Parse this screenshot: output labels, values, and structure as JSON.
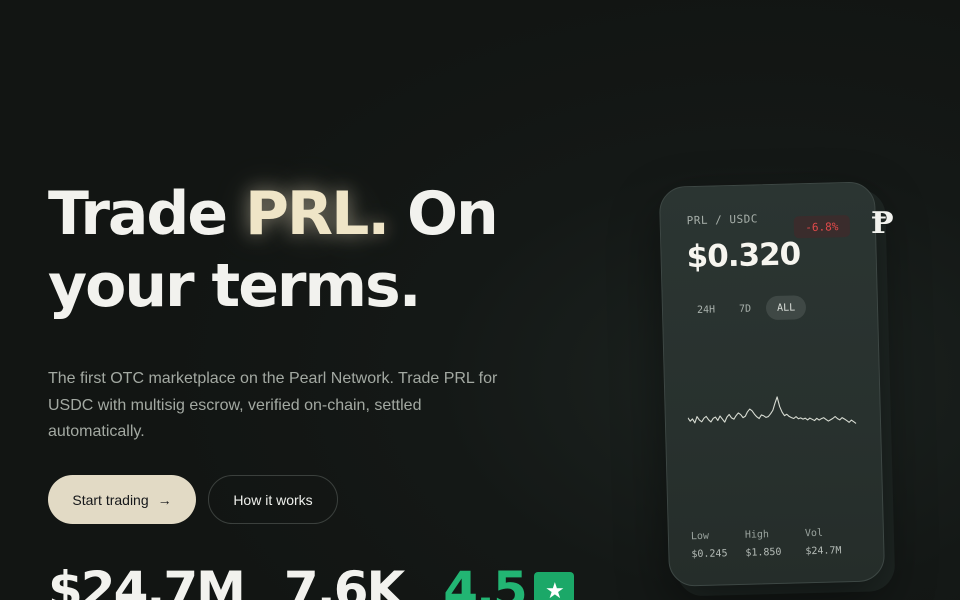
{
  "hero": {
    "title_prefix": "Trade ",
    "title_accent": "PRL.",
    "title_suffix": " On your terms.",
    "subtitle": "The first OTC marketplace on the Pearl Network. Trade PRL for USDC with multisig escrow, verified on-chain, settled automatically.",
    "primary_button": "Start trading",
    "primary_button_icon": "arrow-right-icon",
    "secondary_button": "How it works"
  },
  "stats": {
    "volume": "$24.7M",
    "trades": "7.6K",
    "rating": "4.5",
    "rating_icon": "star-icon"
  },
  "ticker_card": {
    "pair": "PRL / USDC",
    "change": "-6.8%",
    "price": "$0.320",
    "ranges": [
      "24H",
      "7D",
      "ALL"
    ],
    "selected_range": "ALL",
    "low_label": "Low",
    "low_value": "$0.245",
    "high_label": "High",
    "high_value": "$1.850",
    "vol_label": "Vol",
    "vol_value": "$24.7M"
  },
  "logo": {
    "glyph": "Ᵽ",
    "icon": "pearl-logo-icon"
  },
  "colors": {
    "background": "#141816",
    "accent": "#efe5c7",
    "primary_button": "#e2dac5",
    "positive": "#22b573",
    "negative": "#e04a4a",
    "card": "#2b3532"
  },
  "sparkline_points": [
    0.58,
    0.5,
    0.55,
    0.46,
    0.6,
    0.52,
    0.48,
    0.56,
    0.6,
    0.52,
    0.47,
    0.55,
    0.58,
    0.5,
    0.6,
    0.53,
    0.46,
    0.57,
    0.63,
    0.55,
    0.52,
    0.6,
    0.66,
    0.62,
    0.55,
    0.58,
    0.68,
    0.74,
    0.7,
    0.62,
    0.56,
    0.52,
    0.6,
    0.58,
    0.54,
    0.56,
    0.62,
    0.7,
    0.86,
    1.0,
    0.78,
    0.65,
    0.57,
    0.6,
    0.55,
    0.52,
    0.5,
    0.54,
    0.49,
    0.51,
    0.48,
    0.5,
    0.46,
    0.5,
    0.47,
    0.44,
    0.49,
    0.45,
    0.48,
    0.5,
    0.46,
    0.42,
    0.45,
    0.48,
    0.52,
    0.47,
    0.44,
    0.49,
    0.46,
    0.42,
    0.38,
    0.43,
    0.39,
    0.35
  ]
}
